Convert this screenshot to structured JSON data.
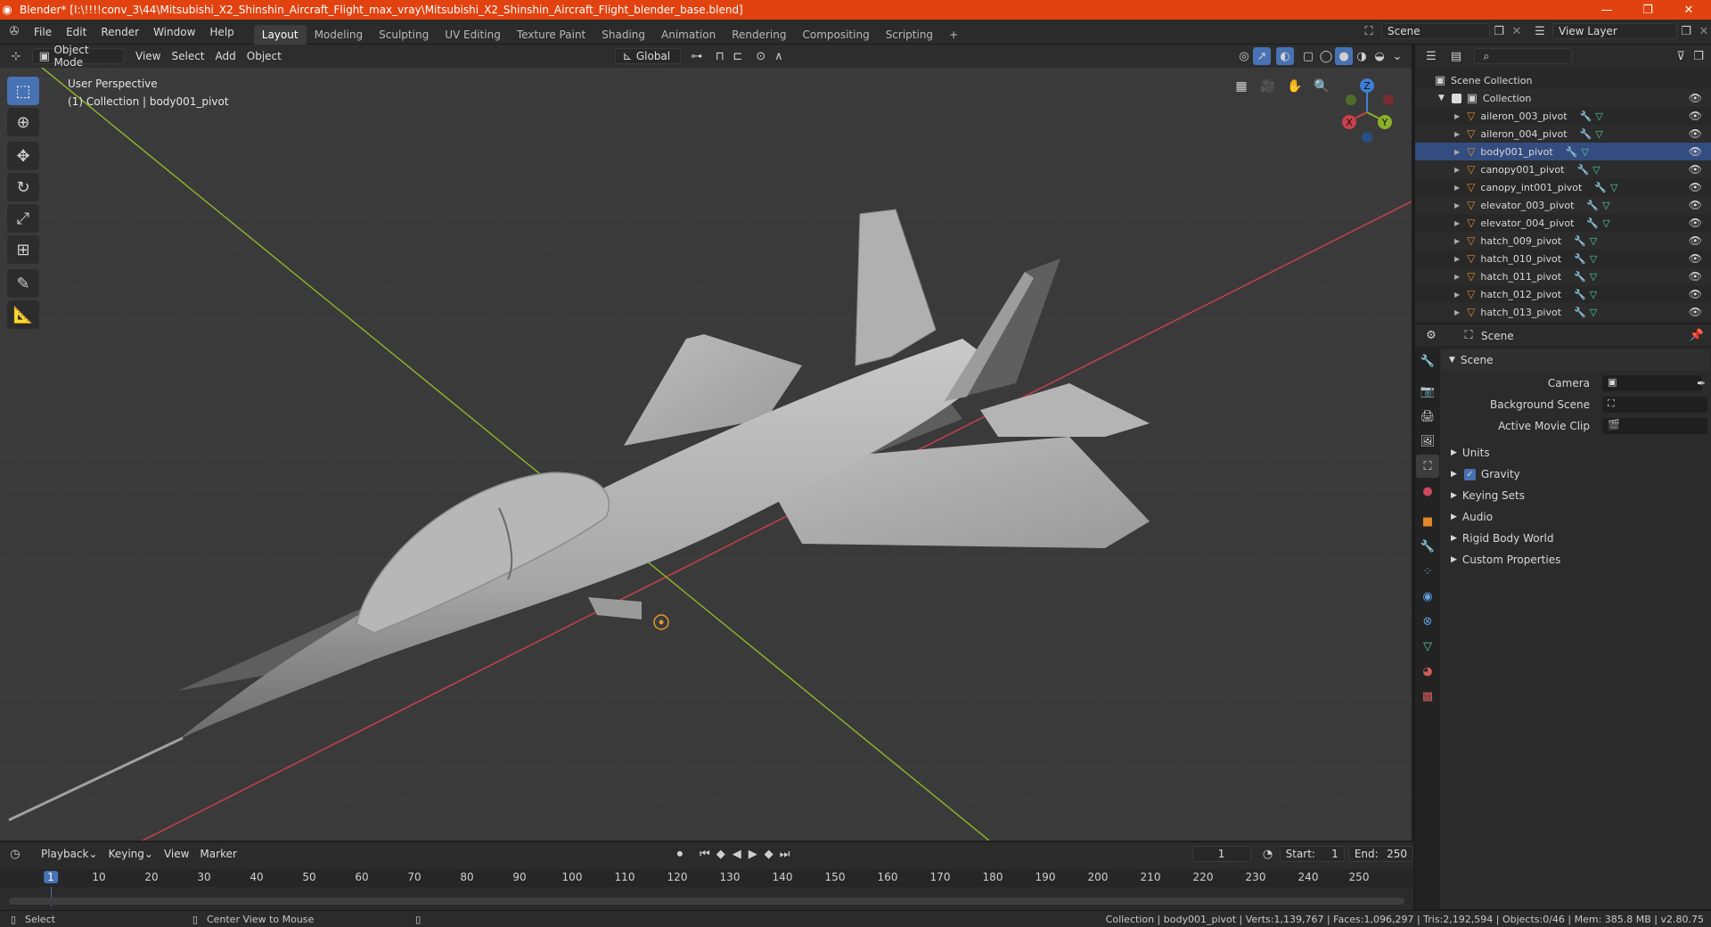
{
  "window": {
    "title": "Blender* [I:\\!!!!conv_3\\44\\Mitsubishi_X2_Shinshin_Aircraft_Flight_max_vray\\Mitsubishi_X2_Shinshin_Aircraft_Flight_blender_base.blend]",
    "controls": [
      "—",
      "❐",
      "✕"
    ]
  },
  "menu": [
    "File",
    "Edit",
    "Render",
    "Window",
    "Help"
  ],
  "workspaces": [
    {
      "label": "Layout",
      "active": true
    },
    {
      "label": "Modeling"
    },
    {
      "label": "Sculpting"
    },
    {
      "label": "UV Editing"
    },
    {
      "label": "Texture Paint"
    },
    {
      "label": "Shading"
    },
    {
      "label": "Animation"
    },
    {
      "label": "Rendering"
    },
    {
      "label": "Compositing"
    },
    {
      "label": "Scripting"
    }
  ],
  "topright": {
    "scene": "Scene",
    "view_layer": "View Layer"
  },
  "viewport": {
    "mode": "Object Mode",
    "menus": [
      "View",
      "Select",
      "Add",
      "Object"
    ],
    "transform_orientation": "Global",
    "overlay_line1": "User Perspective",
    "overlay_line2": "(1) Collection | body001_pivot",
    "gizmo": {
      "x": "X",
      "y": "Y",
      "z": "Z"
    }
  },
  "outliner": {
    "root": "Scene Collection",
    "collection": "Collection",
    "items": [
      "aileron_003_pivot",
      "aileron_004_pivot",
      "body001_pivot",
      "canopy001_pivot",
      "canopy_int001_pivot",
      "elevator_003_pivot",
      "elevator_004_pivot",
      "hatch_009_pivot",
      "hatch_010_pivot",
      "hatch_011_pivot",
      "hatch_012_pivot",
      "hatch_013_pivot"
    ]
  },
  "properties": {
    "context": "Scene",
    "panel": "Scene",
    "fields": [
      {
        "label": "Camera"
      },
      {
        "label": "Background Scene"
      },
      {
        "label": "Active Movie Clip"
      }
    ],
    "subpanels": [
      "Units",
      "Gravity",
      "Keying Sets",
      "Audio",
      "Rigid Body World",
      "Custom Properties"
    ]
  },
  "timeline": {
    "menus": [
      "Playback",
      "Keying",
      "View",
      "Marker"
    ],
    "current_frame": "1",
    "start_label": "Start:",
    "start": "1",
    "end_label": "End:",
    "end": "250",
    "ticks": [
      "1",
      "10",
      "20",
      "30",
      "40",
      "50",
      "60",
      "70",
      "80",
      "90",
      "100",
      "110",
      "120",
      "130",
      "140",
      "150",
      "160",
      "170",
      "180",
      "190",
      "200",
      "210",
      "220",
      "230",
      "240",
      "250"
    ]
  },
  "status": {
    "left1": "Select",
    "left2": "Center View to Mouse",
    "right": "Collection | body001_pivot | Verts:1,139,767 | Faces:1,096,297 | Tris:2,192,594 | Objects:0/46 | Mem: 385.8 MB | v2.80.75"
  },
  "colors": {
    "accent": "#4772b3",
    "titlebar": "#e2420f",
    "x_axis": "#c8404a",
    "y_axis": "#8ab02a",
    "z_axis": "#3f7fd8"
  }
}
